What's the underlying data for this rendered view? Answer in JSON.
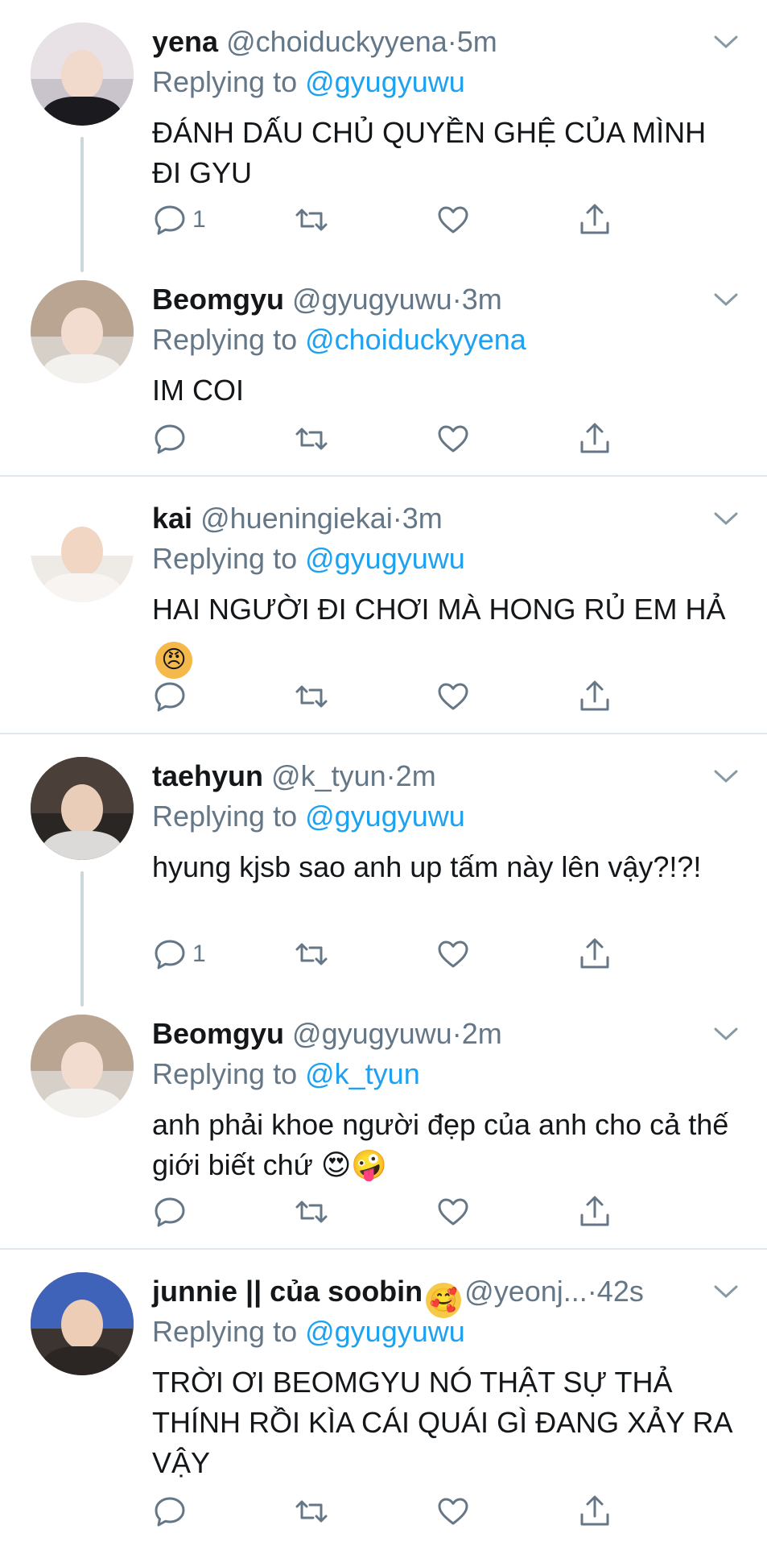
{
  "tweets": [
    {
      "name": "yena",
      "handle": "@choiduckyyena",
      "dot": "·",
      "time": "5m",
      "replying_label": "Replying to ",
      "replying_to": "@gyugyuwu",
      "text": "ĐÁNH DẤU CHỦ QUYỀN GHỆ CỦA MÌNH ĐI GYU",
      "reply_count": "1"
    },
    {
      "name": "Beomgyu",
      "handle": "@gyugyuwu",
      "dot": "·",
      "time": "3m",
      "replying_label": "Replying to ",
      "replying_to": "@choiduckyyena",
      "text": "IM COI",
      "reply_count": ""
    },
    {
      "name": "kai",
      "handle": "@hueningiekai",
      "dot": "·",
      "time": "3m",
      "replying_label": "Replying to ",
      "replying_to": "@gyugyuwu",
      "text": "HAI NGƯỜI ĐI CHƠI MÀ HONG RỦ EM HẢ",
      "emoji": "😠",
      "reply_count": ""
    },
    {
      "name": "taehyun",
      "handle": "@k_tyun",
      "dot": "·",
      "time": "2m",
      "replying_label": "Replying to ",
      "replying_to": "@gyugyuwu",
      "text": "hyung kjsb sao anh up tấm này lên vậy?!?!",
      "reply_count": "1"
    },
    {
      "name": "Beomgyu",
      "handle": "@gyugyuwu",
      "dot": "·",
      "time": "2m",
      "replying_label": "Replying to ",
      "replying_to": "@k_tyun",
      "text": "anh phải khoe người đẹp của anh cho cả thế giới biết chứ",
      "emoji": "😍🤪",
      "reply_count": ""
    },
    {
      "name": "junnie || của soobin",
      "name_emoji": "🥰",
      "handle": "@yeonj...",
      "dot": "·",
      "time": "42s",
      "replying_label": "Replying to ",
      "replying_to": "@gyugyuwu",
      "text": "TRỜI ƠI BEOMGYU NÓ THẬT SỰ THẢ THÍNH RỒI KÌA CÁI QUÁI GÌ ĐANG XẢY RA VẬY",
      "reply_count": ""
    }
  ],
  "icons": {
    "reply": "reply-icon",
    "retweet": "retweet-icon",
    "like": "heart-icon",
    "share": "share-icon",
    "more": "chevron-down-icon"
  },
  "colors": {
    "link": "#1da1f2",
    "secondary_text": "#657786",
    "divider": "#e1e8ed",
    "thread_line": "#ccd6dd"
  }
}
